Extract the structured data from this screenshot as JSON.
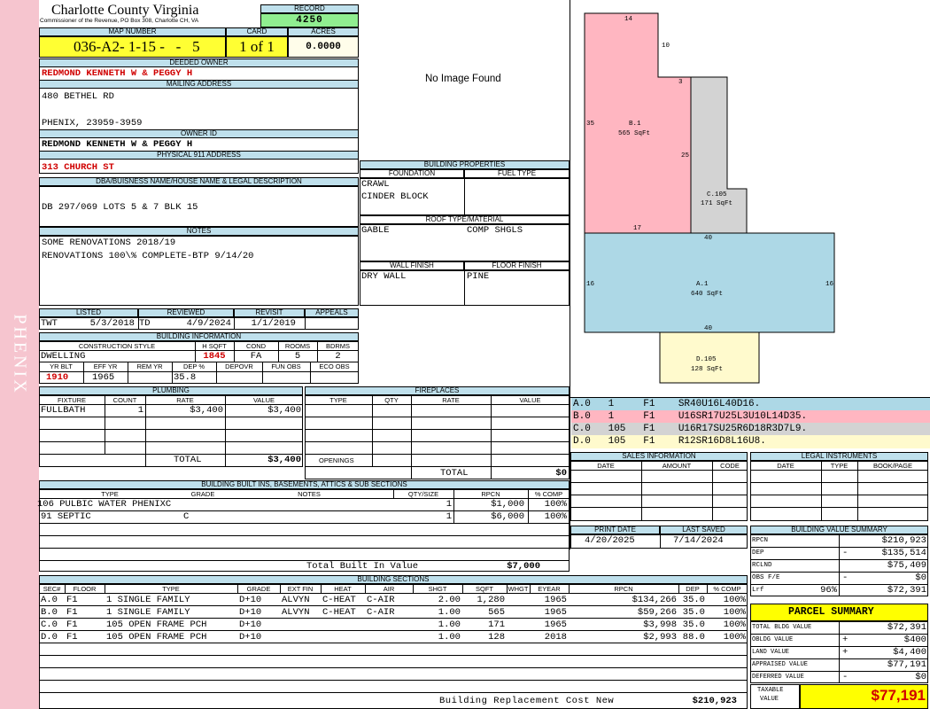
{
  "county": "Charlotte County Virginia",
  "commissioner": "Commissioner of the Revenue, PO Box 308, Charlotte CH, VA",
  "sidebar": "PHENIX",
  "record": {
    "label": "RECORD",
    "value": "4250"
  },
  "map": {
    "label": "MAP NUMBER",
    "value": "036-A2- 1-15 -   -   5",
    "card_label": "CARD",
    "card": "1 of 1",
    "acres_label": "ACRES",
    "acres": "0.0000"
  },
  "deeded": {
    "label": "DEEDED OWNER",
    "value": "REDMOND KENNETH W & PEGGY H"
  },
  "mailing": {
    "label": "MAILING ADDRESS",
    "line1": "480 BETHEL RD",
    "line2": "PHENIX,  23959-3959"
  },
  "owner_id": {
    "label": "OWNER ID",
    "value": "REDMOND KENNETH W & PEGGY H"
  },
  "physical": {
    "label": "PHYSICAL 911 ADDRESS",
    "value": "313 CHURCH ST"
  },
  "dba": {
    "label": "DBA/BUISNESS NAME/HOUSE NAME & LEGAL DESCRIPTION",
    "value": "DB 297/069 LOTS 5 & 7 BLK 15"
  },
  "notes": {
    "label": "NOTES",
    "line1": "SOME RENOVATIONS 2018/19",
    "line2": "RENOVATIONS 100\\% COMPLETE-BTP 9/14/20"
  },
  "image_text": "No Image Found",
  "bprops": {
    "label": "BUILDING PROPERTIES",
    "foundation_label": "FOUNDATION",
    "fuel_label": "FUEL TYPE",
    "foundation1": "CRAWL",
    "foundation2": "CINDER BLOCK",
    "roof_label": "ROOF TYPE/MATERIAL",
    "roof1": "GABLE",
    "roof2": "COMP SHGLS",
    "wall_label": "WALL FINISH",
    "floor_label": "FLOOR FINISH",
    "wall": "DRY WALL",
    "floor": "PINE"
  },
  "listed": {
    "h_listed": "LISTED",
    "h_reviewed": "REVIEWED",
    "h_revisit": "REVISIT",
    "h_appeals": "APPEALS",
    "by": "TWT",
    "listed": "5/3/2018",
    "rev_by": "TD",
    "reviewed": "4/9/2024",
    "revisit": "1/1/2019"
  },
  "binfo": {
    "label": "BUILDING INFORMATION",
    "h_style": "CONSTRUCTION STYLE",
    "h_hsqft": "H SQFT",
    "h_cond": "COND",
    "h_rooms": "ROOMS",
    "h_bdrms": "BDRMS",
    "style": "DWELLING",
    "hsqft": "1845",
    "cond": "FA",
    "rooms": "5",
    "bdrms": "2",
    "h_yrblt": "YR BLT",
    "h_effyr": "EFF YR",
    "h_remyr": "REM YR",
    "h_dep": "DEP %",
    "h_depovr": "DEPOVR",
    "h_funobs": "FUN OBS",
    "h_ecoobs": "ECO OBS",
    "yrblt": "1910",
    "effyr": "1965",
    "dep": "35.8"
  },
  "plumbing": {
    "label": "PLUMBING",
    "h_fixture": "FIXTURE",
    "h_count": "COUNT",
    "h_rate": "RATE",
    "h_value": "VALUE",
    "fixture": "FULLBATH",
    "count": "1",
    "rate": "$3,400",
    "value": "$3,400",
    "total_label": "TOTAL",
    "total": "$3,400"
  },
  "fireplaces": {
    "label": "FIREPLACES",
    "h_type": "TYPE",
    "h_qty": "QTY",
    "h_rate": "RATE",
    "h_value": "VALUE",
    "openings": "OPENINGS",
    "total_label": "TOTAL",
    "total": "$0"
  },
  "builtins": {
    "label": "BUILDING BUILT INS, BASEMENTS, ATTICS & SUB SECTIONS",
    "h_type": "TYPE",
    "h_grade": "GRADE",
    "h_notes": "NOTES",
    "h_qty": "QTY/SIZE",
    "h_rpcn": "RPCN",
    "h_comp": "% COMP",
    "rows": [
      {
        "type": "106 PULBIC WATER PHENIXC",
        "grade": "",
        "qty": "1",
        "rpcn": "$1,000",
        "comp": "100%"
      },
      {
        "type": "91 SEPTIC",
        "grade": "C",
        "qty": "1",
        "rpcn": "$6,000",
        "comp": "100%"
      }
    ],
    "total_label": "Total Built In Value",
    "total": "$7,000"
  },
  "sections": {
    "label": "BUILDING SECTIONS",
    "headers": [
      "SEC#",
      "FLOOR",
      "TYPE",
      "GRADE",
      "EXT FIN",
      "HEAT",
      "AIR",
      "SHGT",
      "SQFT",
      "WHGT",
      "EYEAR",
      "RPCN",
      "DEP",
      "% COMP"
    ],
    "rows": [
      [
        "A.0",
        "F1",
        "1 SINGLE FAMILY",
        "D+10",
        "ALVYN",
        "C-HEAT",
        "C-AIR",
        "2.00",
        "1,280",
        "",
        "1965",
        "$134,266",
        "35.0",
        "100%"
      ],
      [
        "B.0",
        "F1",
        "1 SINGLE FAMILY",
        "D+10",
        "ALVYN",
        "C-HEAT",
        "C-AIR",
        "1.00",
        "565",
        "",
        "1965",
        "$59,266",
        "35.0",
        "100%"
      ],
      [
        "C.0",
        "F1",
        "105 OPEN FRAME PCH",
        "D+10",
        "",
        "",
        "",
        "1.00",
        "171",
        "",
        "1965",
        "$3,998",
        "35.0",
        "100%"
      ],
      [
        "D.0",
        "F1",
        "105 OPEN FRAME PCH",
        "D+10",
        "",
        "",
        "",
        "1.00",
        "128",
        "",
        "2018",
        "$2,993",
        "88.0",
        "100%"
      ]
    ],
    "brcn_label": "Building Replacement Cost New",
    "brcn": "$210,923"
  },
  "sketch": {
    "areas": [
      {
        "name": "B.1",
        "sqft": "565 SqFt"
      },
      {
        "name": "C.105",
        "sqft": "171 SqFt"
      },
      {
        "name": "A.1",
        "sqft": "640 SqFt"
      },
      {
        "name": "D.105",
        "sqft": "128 SqFt"
      }
    ],
    "dims": [
      "14",
      "10",
      "3",
      "35",
      "25",
      "17",
      "40",
      "16",
      "16",
      "40"
    ],
    "colors": {
      "A": "#add8e6",
      "B": "#ffb6c1",
      "C": "#d3d3d3",
      "D": "#fffacd"
    }
  },
  "vectors": [
    {
      "text": "A.0   1     F1    SR40U16L40D16.",
      "color": "#add8e6"
    },
    {
      "text": "B.0   1     F1    U16SR17U25L3U10L14D35.",
      "color": "#ffb6c1"
    },
    {
      "text": "C.0   105   F1    U16R17SU25R6D18R3D7L9.",
      "color": "#d3d3d3"
    },
    {
      "text": "D.0   105   F1    R12SR16D8L16U8.",
      "color": "#fffacd"
    }
  ],
  "sales": {
    "label": "SALES INFORMATION",
    "h_date": "DATE",
    "h_amount": "AMOUNT",
    "h_code": "CODE"
  },
  "legal": {
    "label": "LEGAL INSTRUMENTS",
    "h_date": "DATE",
    "h_type": "TYPE",
    "h_book": "BOOK/PAGE"
  },
  "print": {
    "h_print": "PRINT DATE",
    "h_saved": "LAST SAVED",
    "print_date": "4/20/2025",
    "last_saved": "7/14/2024"
  },
  "bvs": {
    "label": "BUILDING VALUE SUMMARY",
    "rpcn_label": "RPCN",
    "rpcn": "$210,923",
    "dep_label": "DEP",
    "dep_sign": "-",
    "dep": "$135,514",
    "rclnd_label": "RCLND",
    "rclnd": "$75,409",
    "obs_label": "OBS F/E",
    "obs_sign": "-",
    "obs": "$0",
    "lrf_label": "Lrf",
    "lrf_pct": "96%",
    "lrf": "$72,391"
  },
  "parcel": {
    "label": "PARCEL SUMMARY",
    "tbv_label": "TOTAL BLDG VALUE",
    "tbv": "$72,391",
    "obldg_label": "OBLDG VALUE",
    "obldg_sign": "+",
    "obldg": "$400",
    "land_label": "LAND VALUE",
    "land_sign": "+",
    "land": "$4,400",
    "appr_label": "APPRAISED VALUE",
    "appr": "$77,191",
    "def_label": "DEFERRED VALUE",
    "def_sign": "-",
    "def": "$0",
    "taxable_label1": "TAXABLE",
    "taxable_label2": "VALUE",
    "taxable": "$77,191"
  }
}
